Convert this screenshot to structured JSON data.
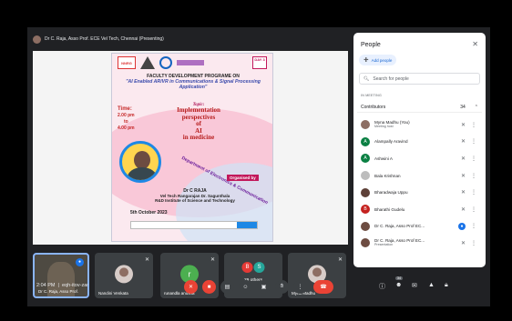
{
  "presenter_bar": {
    "label": "Dr C. Raja, Asso Prof. ECE Vel Tech, Chennai (Presenting)"
  },
  "poster": {
    "logos": [
      "NNRG"
    ],
    "day": "DAY 3",
    "heading_line1": "FACULTY DEVELOPMENT PROGRAME ON",
    "heading_line2": "\"AI Enabled AR/VR in Communications & Signal Processing Application\"",
    "time_label": "Time:",
    "time_from": "2.00 pm",
    "time_to_word": "to",
    "time_to": "4.00 pm",
    "topic_label": "Topic:",
    "topic_lines": [
      "Implementation",
      "perspectives",
      "of",
      "AI",
      "in medicine"
    ],
    "department": "Department of Electronics & Communication",
    "organised_by": "Organised by",
    "speaker_name": "Dr C RAJA",
    "speaker_affil1": "Vel Tech Rangarajan Dr. Sagunthala",
    "speaker_affil2": "R&D Institute of Science and Technology",
    "date": "5th October 2023",
    "reg_button": "Join Meeting"
  },
  "tiles": {
    "self": {
      "name": "Dr C. Raja, Asso Prof."
    },
    "nandini": {
      "name": "Nandini Venkata"
    },
    "runandla": {
      "name": "runandla anusha",
      "initial": "r",
      "color": "#4caf50"
    },
    "others": {
      "count": "29 others",
      "initials": [
        "B",
        "S"
      ],
      "colors": [
        "#e53935",
        "#26a69a"
      ]
    },
    "myna": {
      "name": "Myna Madhu"
    }
  },
  "people_panel": {
    "title": "People",
    "add_people": "Add people",
    "search_placeholder": "Search for people",
    "section_label": "IN MEETING",
    "contributors_label": "Contributors",
    "contributors_count": "34",
    "participants": [
      {
        "name": "Myna Madhu (You)",
        "sub": "Meeting host",
        "initial": "",
        "color": "#8d6e63",
        "photo": true,
        "mic": "muted"
      },
      {
        "name": "Alampally Aravind",
        "sub": "",
        "initial": "A",
        "color": "#0b8043",
        "photo": false,
        "mic": "muted"
      },
      {
        "name": "Ashwini A",
        "sub": "",
        "initial": "A",
        "color": "#0b8043",
        "photo": false,
        "mic": "muted"
      },
      {
        "name": "Bala Krishnan",
        "sub": "",
        "initial": "",
        "color": "#bdbdbd",
        "photo": true,
        "mic": "muted"
      },
      {
        "name": "Bharadwaja Uppu",
        "sub": "",
        "initial": "",
        "color": "#5d4037",
        "photo": true,
        "mic": "muted"
      },
      {
        "name": "Bharathi Gudelu",
        "sub": "",
        "initial": "B",
        "color": "#c5221f",
        "photo": false,
        "mic": "muted"
      },
      {
        "name": "Dr C. Raja, Asso Prof EC...",
        "sub": "",
        "initial": "",
        "color": "#6d4c41",
        "photo": true,
        "mic": "speaking"
      },
      {
        "name": "Dr C. Raja, Asso Prof EC...",
        "sub": "Presentation",
        "initial": "",
        "color": "#6d4c41",
        "photo": true,
        "mic": "muted"
      }
    ]
  },
  "bottom_bar": {
    "time": "2:04 PM",
    "meeting_code": "eqh-itov-zar",
    "people_badge": "34"
  }
}
